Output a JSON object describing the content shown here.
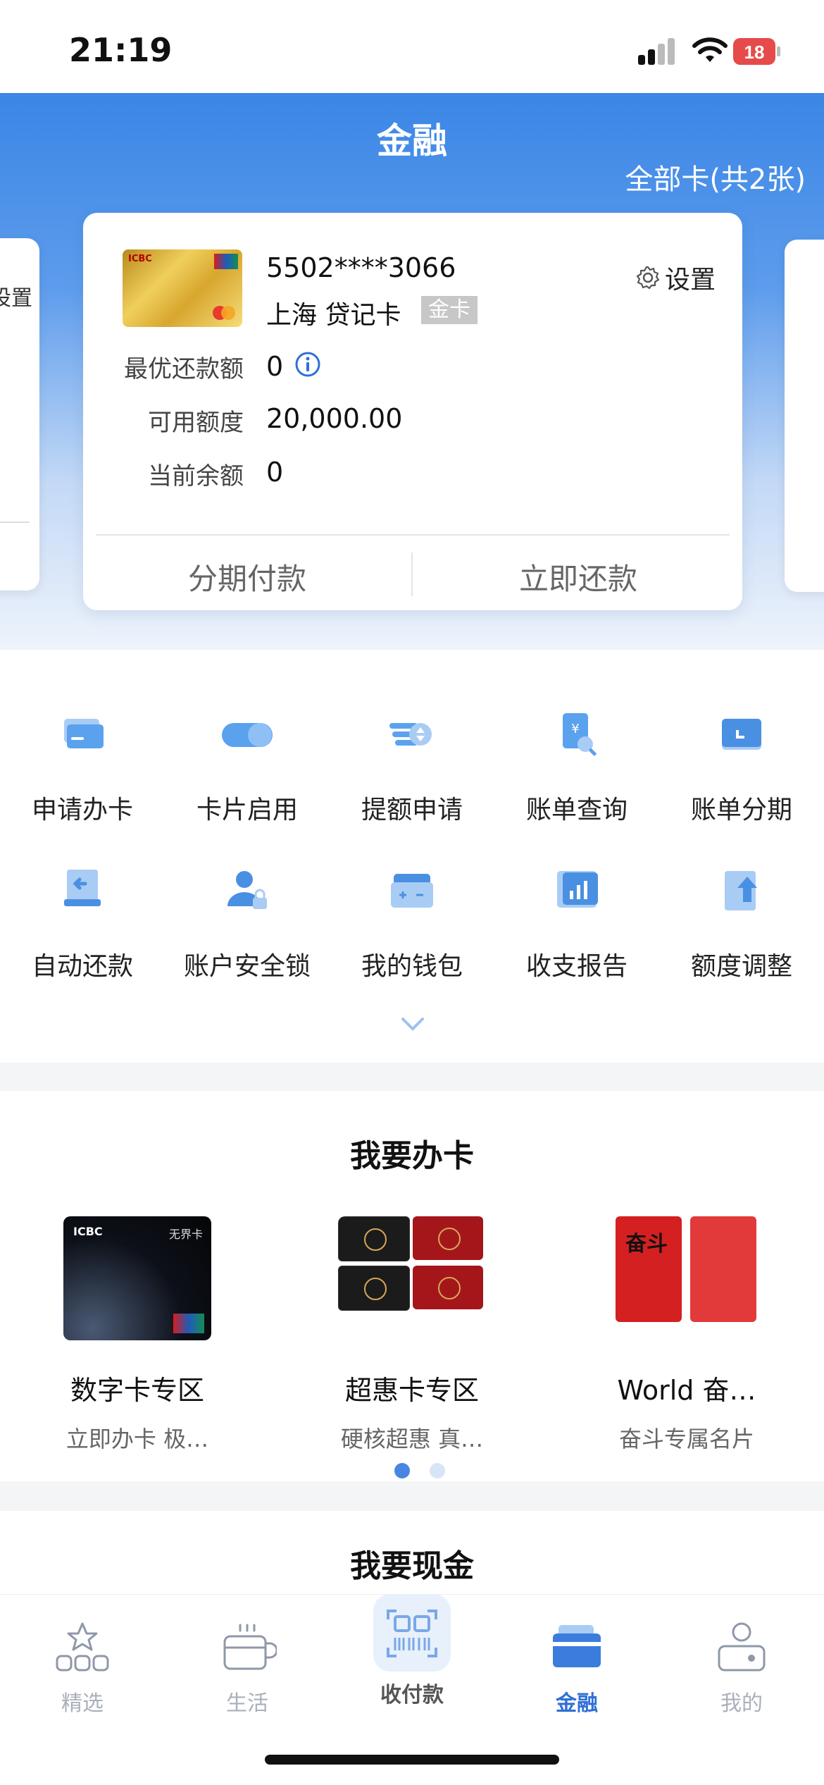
{
  "status_bar": {
    "time": "21:19",
    "battery": "18"
  },
  "header": {
    "title": "金融",
    "all_cards": "全部卡(共2张)",
    "left_peek_text": "设置"
  },
  "card": {
    "number": "5502****3066",
    "type": "上海 贷记卡",
    "badge": "金卡",
    "settings_label": "设置",
    "rows": [
      {
        "label": "最优还款额",
        "value": "0"
      },
      {
        "label": "可用额度",
        "value": "20,000.00"
      },
      {
        "label": "当前余额",
        "value": "0"
      }
    ],
    "actions": {
      "installment": "分期付款",
      "repay": "立即还款"
    }
  },
  "functions": [
    {
      "label": "申请办卡",
      "icon": "card-apply-icon"
    },
    {
      "label": "卡片启用",
      "icon": "toggle-icon"
    },
    {
      "label": "提额申请",
      "icon": "limit-raise-icon"
    },
    {
      "label": "账单查询",
      "icon": "bill-search-icon"
    },
    {
      "label": "账单分期",
      "icon": "bill-installment-icon"
    },
    {
      "label": "自动还款",
      "icon": "auto-repay-icon"
    },
    {
      "label": "账户安全锁",
      "icon": "account-lock-icon"
    },
    {
      "label": "我的钱包",
      "icon": "wallet-icon"
    },
    {
      "label": "收支报告",
      "icon": "report-icon"
    },
    {
      "label": "额度调整",
      "icon": "limit-adjust-icon"
    }
  ],
  "apply_section": {
    "title": "我要办卡",
    "items": [
      {
        "title": "数字卡专区",
        "subtitle": "立即办卡 极…",
        "card_text": "ICBC",
        "card_text2": "无界卡"
      },
      {
        "title": "超惠卡专区",
        "subtitle": "硬核超惠 真…"
      },
      {
        "title": "World 奋…",
        "subtitle": "奋斗专属名片",
        "card_text": "奋斗"
      }
    ]
  },
  "cash_section": {
    "title": "我要现金"
  },
  "tabs": [
    {
      "label": "精选",
      "icon": "star-icon"
    },
    {
      "label": "生活",
      "icon": "cup-icon"
    },
    {
      "label": "收付款",
      "icon": "scan-pay-icon"
    },
    {
      "label": "金融",
      "icon": "card-icon",
      "active": true
    },
    {
      "label": "我的",
      "icon": "profile-icon"
    }
  ],
  "colors": {
    "primary": "#2f6fd6",
    "icon_blue": "#4a90e2",
    "inactive": "#aab0ba"
  }
}
